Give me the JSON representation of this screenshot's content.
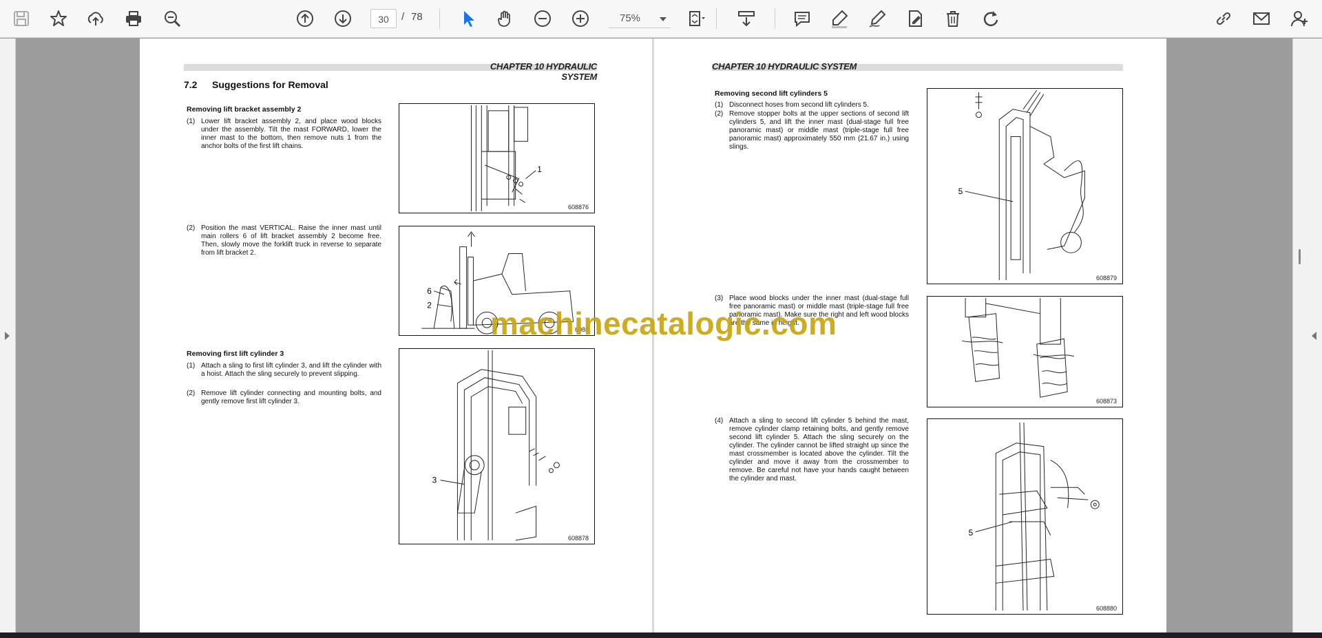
{
  "toolbar": {
    "page_current": "30",
    "page_separator": "/",
    "page_total": "78",
    "zoom_value": "75%"
  },
  "left_page": {
    "chapter_header": "CHAPTER 10 HYDRAULIC SYSTEM",
    "section_number": "7.2",
    "section_title": "Suggestions for Removal",
    "block1": {
      "title": "Removing lift bracket assembly 2",
      "steps": [
        {
          "num": "(1)",
          "text": "Lower lift bracket assembly 2, and place wood blocks under the assembly. Tilt the mast FORWARD, lower the inner mast to the bottom, then remove nuts 1 from the anchor bolts of the first lift chains."
        },
        {
          "num": "(2)",
          "text": "Position the mast VERTICAL. Raise the inner mast until main rollers 6 of lift bracket assembly 2 become free. Then, slowly move the forklift truck in reverse to separate from lift bracket 2."
        }
      ]
    },
    "block2": {
      "title": "Removing first lift cylinder 3",
      "steps": [
        {
          "num": "(1)",
          "text": "Attach a sling to first lift cylinder 3, and lift the cylinder with a hoist. Attach the sling securely to prevent slipping."
        },
        {
          "num": "(2)",
          "text": "Remove lift cylinder connecting and mounting bolts, and gently remove first lift cylinder 3."
        }
      ]
    },
    "figures": [
      {
        "id": "608876",
        "callouts": [
          "1"
        ]
      },
      {
        "id": "6088",
        "callouts": [
          "6",
          "2"
        ]
      },
      {
        "id": "608878",
        "callouts": [
          "3"
        ]
      }
    ]
  },
  "right_page": {
    "chapter_header": "CHAPTER 10 HYDRAULIC SYSTEM",
    "block1": {
      "title": "Removing second lift cylinders 5",
      "steps": [
        {
          "num": "(1)",
          "text": "Disconnect hoses from second lift cylinders 5."
        },
        {
          "num": "(2)",
          "text": "Remove stopper bolts at the upper sections of second lift cylinders 5, and lift the inner mast (dual-stage full free panoramic mast) or middle mast (triple-stage full free panoramic mast) approximately 550 mm (21.67 in.) using slings."
        },
        {
          "num": "(3)",
          "text": "Place wood blocks under the inner mast (dual-stage full free panoramic mast) or middle mast (triple-stage full free panoramic mast). Make sure the right and left wood blocks are the same in height."
        },
        {
          "num": "(4)",
          "text": "Attach a sling to second lift cylinder 5 behind the mast, remove cylinder clamp retaining bolts, and gently remove second lift cylinder 5. Attach the sling securely on the cylinder. The cylinder cannot be lifted straight up since the mast crossmember is located above the cylinder. Tilt the cylinder and move it away from the crossmember to remove. Be careful not have your hands caught between the cylinder and mast."
        }
      ]
    },
    "figures": [
      {
        "id": "608879",
        "callouts": [
          "5"
        ]
      },
      {
        "id": "608873",
        "callouts": []
      },
      {
        "id": "608880",
        "callouts": [
          "5"
        ]
      }
    ]
  },
  "watermark": "machinecatalogic.com",
  "icons": [
    "save-icon",
    "star-icon",
    "upload-icon",
    "print-icon",
    "zoom-search-icon",
    "page-up-icon",
    "page-down-icon",
    "select-cursor-icon",
    "hand-icon",
    "zoom-out-icon",
    "zoom-in-icon",
    "fit-page-icon",
    "scroll-mode-icon",
    "comment-icon",
    "highlight-icon",
    "draw-icon",
    "fill-sign-icon",
    "delete-icon",
    "rotate-icon",
    "link-icon",
    "mail-icon",
    "add-user-icon"
  ],
  "colors": {
    "accent": "#1a73e8",
    "watermark": "#c8a40a",
    "toolbar_bg": "#f7f7f7",
    "viewer_bg": "#9c9c9c"
  }
}
